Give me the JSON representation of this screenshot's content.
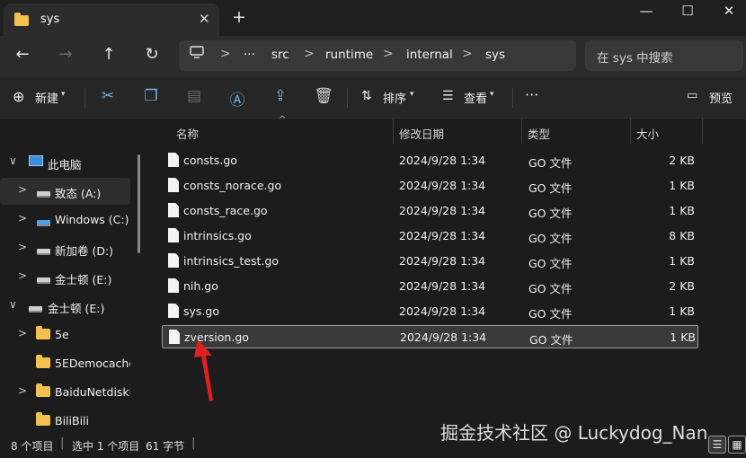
{
  "window": {
    "tab_title": "sys",
    "tab_close": "✕",
    "new_tab": "+",
    "minimize": "—",
    "maximize": "☐",
    "close": "✕"
  },
  "nav": {
    "back": "←",
    "forward": "→",
    "up": "↑",
    "refresh": "↻",
    "computer_icon": "🖥",
    "overflow": "···",
    "breadcrumbs": [
      "src",
      "runtime",
      "internal",
      "sys"
    ],
    "sep": ">",
    "search_placeholder": "在 sys 中搜索"
  },
  "toolbar": {
    "new_label": "新建",
    "sort_label": "排序",
    "view_label": "查看",
    "more": "···",
    "preview_label": "预览",
    "icons": [
      "cut-icon",
      "copy-icon",
      "paste-icon",
      "rename-icon",
      "share-icon",
      "delete-icon"
    ]
  },
  "sidebar": {
    "items": [
      {
        "label": "此电脑",
        "icon": "pc-icon",
        "chevron": "∨"
      },
      {
        "label": "致态 (A:)",
        "icon": "drive-icon",
        "chevron": ">"
      },
      {
        "label": "Windows (C:)",
        "icon": "windows-drive-icon",
        "chevron": ">"
      },
      {
        "label": "新加卷 (D:)",
        "icon": "drive-icon",
        "chevron": ">"
      },
      {
        "label": "金士顿 (E:)",
        "icon": "drive-icon",
        "chevron": ">"
      },
      {
        "label": "金士顿 (E:)",
        "icon": "drive-icon",
        "chevron": "∨"
      },
      {
        "label": "5e",
        "icon": "folder-icon",
        "chevron": ">"
      },
      {
        "label": "5EDemocache",
        "icon": "folder-icon",
        "chevron": ""
      },
      {
        "label": "BaiduNetdiskD",
        "icon": "folder-icon",
        "chevron": ">"
      },
      {
        "label": "BiliBili",
        "icon": "folder-icon",
        "chevron": ""
      }
    ]
  },
  "table": {
    "columns": [
      "名称",
      "修改日期",
      "类型",
      "大小"
    ],
    "rows": [
      {
        "name": "consts.go",
        "date": "2024/9/28 1:34",
        "type": "GO 文件",
        "size": "2 KB"
      },
      {
        "name": "consts_norace.go",
        "date": "2024/9/28 1:34",
        "type": "GO 文件",
        "size": "1 KB"
      },
      {
        "name": "consts_race.go",
        "date": "2024/9/28 1:34",
        "type": "GO 文件",
        "size": "1 KB"
      },
      {
        "name": "intrinsics.go",
        "date": "2024/9/28 1:34",
        "type": "GO 文件",
        "size": "8 KB"
      },
      {
        "name": "intrinsics_test.go",
        "date": "2024/9/28 1:34",
        "type": "GO 文件",
        "size": "1 KB"
      },
      {
        "name": "nih.go",
        "date": "2024/9/28 1:34",
        "type": "GO 文件",
        "size": "2 KB"
      },
      {
        "name": "sys.go",
        "date": "2024/9/28 1:34",
        "type": "GO 文件",
        "size": "1 KB"
      },
      {
        "name": "zversion.go",
        "date": "2024/9/28 1:34",
        "type": "GO 文件",
        "size": "1 KB"
      }
    ],
    "selected_row": 7
  },
  "status": {
    "count": "8 个项目",
    "selected": "选中 1 个项目",
    "bytes": "61 字节",
    "sep": "|"
  },
  "watermark": "掘金技术社区 @ Luckydog_Nan",
  "colors": {
    "annotation_arrow": "#e02020",
    "folder": "#f2c14e"
  }
}
